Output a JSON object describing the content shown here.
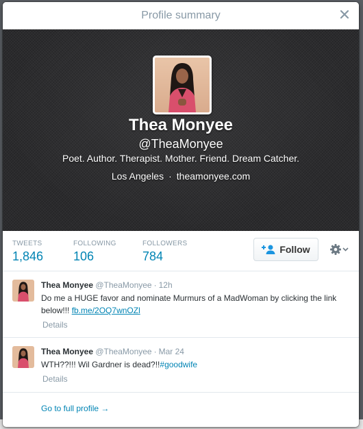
{
  "modal": {
    "title": "Profile summary",
    "close_label": "×"
  },
  "profile": {
    "name": "Thea Monyee",
    "handle": "@TheaMonyee",
    "bio": "Poet. Author. Therapist. Mother. Friend. Dream Catcher.",
    "location": "Los Angeles",
    "separator": "·",
    "website": "theamonyee.com"
  },
  "stats": {
    "tweets": {
      "label": "TWEETS",
      "value": "1,846"
    },
    "following": {
      "label": "FOLLOWING",
      "value": "106"
    },
    "followers": {
      "label": "FOLLOWERS",
      "value": "784"
    }
  },
  "actions": {
    "follow_label": "Follow"
  },
  "tweets": [
    {
      "name": "Thea Monyee",
      "handle": "@TheaMonyee",
      "dot": "·",
      "time": "12h",
      "text": "Do me a HUGE favor and nominate Murmurs of a MadWoman by clicking the link below!!! ",
      "link": "fb.me/2OQ7wnOZl",
      "details": "Details"
    },
    {
      "name": "Thea Monyee",
      "handle": "@TheaMonyee",
      "dot": "·",
      "time": "Mar 24",
      "text": "WTH??!!! Wil Gardner is dead?!!",
      "hashtag": "#goodwife",
      "details": "Details"
    }
  ],
  "footer": {
    "full_profile_label": "Go to full profile →"
  },
  "colors": {
    "link": "#0084b4",
    "muted": "#8899a6",
    "cover": "#2b2b2d"
  }
}
